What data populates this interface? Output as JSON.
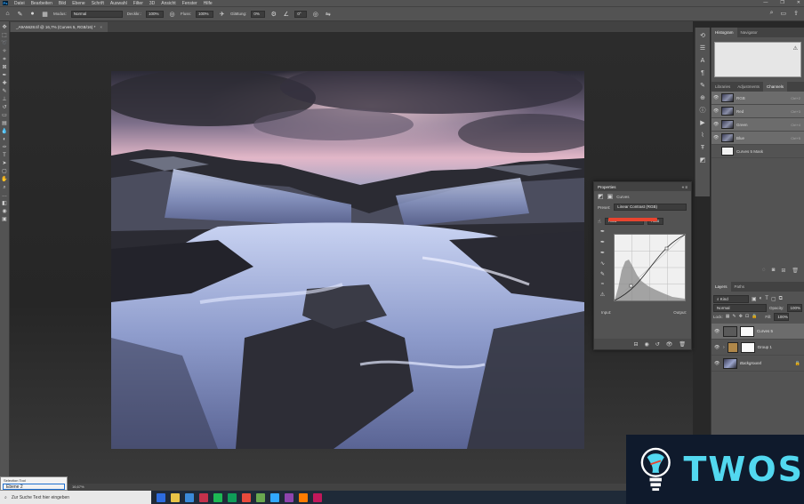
{
  "menubar": {
    "app_icon": "Ps",
    "items": [
      "Datei",
      "Bearbeiten",
      "Bild",
      "Ebene",
      "Schrift",
      "Auswahl",
      "Filter",
      "3D",
      "Ansicht",
      "Fenster",
      "Hilfe"
    ],
    "window_controls": [
      "—",
      "❐",
      "✕"
    ]
  },
  "options": {
    "mode_label": "Modus:",
    "mode_value": "Normal",
    "opacity_label": "Deckkr.:",
    "opacity_value": "100%",
    "flow_label": "Fluss:",
    "flow_value": "100%",
    "smoothing_label": "Glättung:",
    "smoothing_value": "0%",
    "angle_value": "0°"
  },
  "document": {
    "tab_title": "_A9A5628.tif @ 16,7% (Curves 5, RGB/16) *",
    "tab_close": "×"
  },
  "statusbar": {
    "zoom": "16,67%"
  },
  "histogram_panel": {
    "tabs": [
      "Histogram",
      "Navigator"
    ],
    "active": 0
  },
  "channels_panel": {
    "tabs": [
      "Libraries",
      "Adjustments",
      "Channels"
    ],
    "active": 2,
    "rows": [
      {
        "name": "RGB",
        "shortcut": "Ctrl+2"
      },
      {
        "name": "Red",
        "shortcut": "Ctrl+3"
      },
      {
        "name": "Green",
        "shortcut": "Ctrl+4"
      },
      {
        "name": "Blue",
        "shortcut": "Ctrl+5"
      },
      {
        "name": "Curves 5 Mask",
        "shortcut": ""
      }
    ]
  },
  "layers_panel": {
    "tabs": [
      "Layers",
      "Paths"
    ],
    "active": 0,
    "kind_label": "Kind",
    "blend_mode": "Normal",
    "opacity_label": "Opacity:",
    "opacity_value": "100%",
    "lock_label": "Lock:",
    "fill_label": "Fill:",
    "fill_value": "100%",
    "layers": [
      {
        "name": "Curves 5",
        "selected": true
      },
      {
        "name": "Group 1",
        "selected": false
      },
      {
        "name": "Background",
        "selected": false
      }
    ]
  },
  "properties": {
    "title": "Properties",
    "subtitle": "Curves",
    "preset_label": "Preset:",
    "preset_value": "Linear Contrast (RGB)",
    "channel_value": "RGB",
    "auto_label": "Auto",
    "input_label": "Input:",
    "output_label": "Output:",
    "collapse": "«",
    "menu": "≡"
  },
  "tooltip": {
    "title": "Selection Tool",
    "value": "Ebene 2"
  },
  "taskbar": {
    "search_placeholder": "Zur Suche Text hier eingeben",
    "icon_colors": [
      "#2d6cdf",
      "#e8c447",
      "#3b8ad9",
      "#c4314b",
      "#1db954",
      "#0f9d58",
      "#e84a3c",
      "#6aa84f",
      "#31a8ff",
      "#8e44ad",
      "#ff7c00",
      "#c2185b"
    ]
  },
  "watermark": {
    "text": "TWOS"
  },
  "colors": {
    "accent_red": "#e8442f",
    "watermark_cyan": "#52d8f0"
  }
}
